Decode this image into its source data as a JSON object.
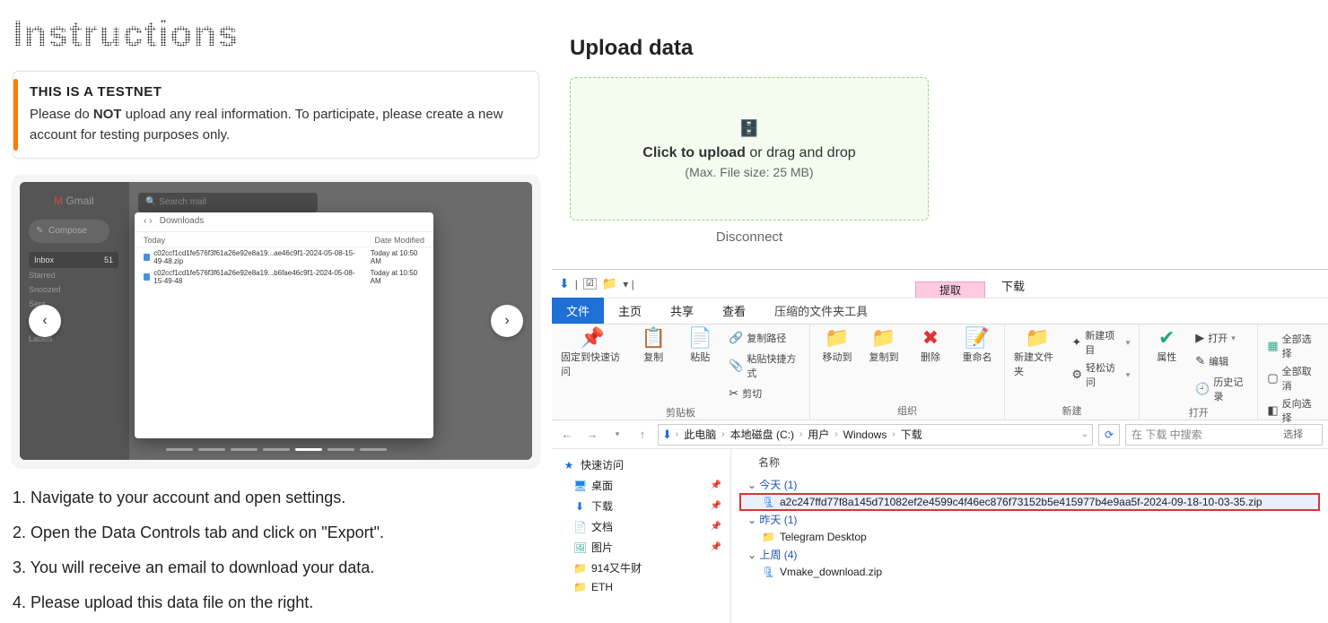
{
  "left": {
    "title": "Instructions",
    "notice": {
      "heading": "THIS IS A TESTNET",
      "body_pre": "Please do ",
      "body_bold": "NOT",
      "body_post": " upload any real information. To participate, please create a new account for testing purposes only."
    },
    "carousel": {
      "gmail": {
        "logo": "Gmail",
        "search": "Search mail",
        "compose": "Compose",
        "inbox": "Inbox",
        "inbox_count": "51",
        "starred": "Starred",
        "snoozed": "Snoozed",
        "sent": "Sent",
        "labels": "Labels"
      },
      "finder": {
        "back_label": "Downloads",
        "group": "Today",
        "col_date": "Date Modified",
        "row1_name": "c02ccf1cd1fe576f3f61a26e92e8a19...ae46c9f1-2024-05-08-15-49-48.zip",
        "row1_date": "Today at 10:50 AM",
        "row2_name": "c02ccf1cd1fe576f3f61a26e92e8a19...b6fae46c9f1-2024-05-08-15-49-48",
        "row2_date": "Today at 10:50 AM"
      }
    },
    "steps": {
      "s1": "1. Navigate to your account and open settings.",
      "s2": "2. Open the Data Controls tab and click on \"Export\".",
      "s3": "3. You will receive an email to download your data.",
      "s4": "4. Please upload this data file on the right."
    }
  },
  "right": {
    "title": "Upload data",
    "drop": {
      "click": "Click to upload",
      "rest": " or drag and drop",
      "limit": "(Max. File size: 25 MB)"
    },
    "disconnect": "Disconnect"
  },
  "explorer": {
    "pink_tab": "提取",
    "dl_tab": "下载",
    "tabs": {
      "file": "文件",
      "home": "主页",
      "share": "共享",
      "view": "查看",
      "zip": "压缩的文件夹工具"
    },
    "ribbon": {
      "pin": "固定到快速访问",
      "copy": "复制",
      "paste": "粘贴",
      "copypath": "复制路径",
      "pastesc": "粘贴快捷方式",
      "cut": "剪切",
      "g1": "剪贴板",
      "moveto": "移动到",
      "copyto": "复制到",
      "delete": "删除",
      "rename": "重命名",
      "g2": "组织",
      "newfolder": "新建文件夹",
      "newitem": "新建项目",
      "easyaccess": "轻松访问",
      "g3": "新建",
      "properties": "属性",
      "open": "打开",
      "edit": "编辑",
      "history": "历史记录",
      "g4": "打开",
      "selectall": "全部选择",
      "selectnone": "全部取消",
      "invert": "反向选择",
      "g5": "选择"
    },
    "crumbs": {
      "pc": "此电脑",
      "c": "本地磁盘 (C:)",
      "users": "用户",
      "win": "Windows",
      "dl": "下载"
    },
    "search_ph": "在 下载 中搜索",
    "tree": {
      "quick": "快速访问",
      "desktop": "桌面",
      "downloads": "下载",
      "docs": "文档",
      "pics": "图片",
      "f1": "914又牛财",
      "f2": "ETH"
    },
    "files": {
      "col_name": "名称",
      "g_today": "今天 (1)",
      "zip_today": "a2c247ffd77f8a145d71082ef2e4599c4f46ec876f73152b5e415977b4e9aa5f-2024-09-18-10-03-35.zip",
      "g_yest": "昨天 (1)",
      "folder_yest": "Telegram Desktop",
      "g_lastwk": "上周 (4)",
      "zip_lastwk": "Vmake_download.zip"
    }
  }
}
